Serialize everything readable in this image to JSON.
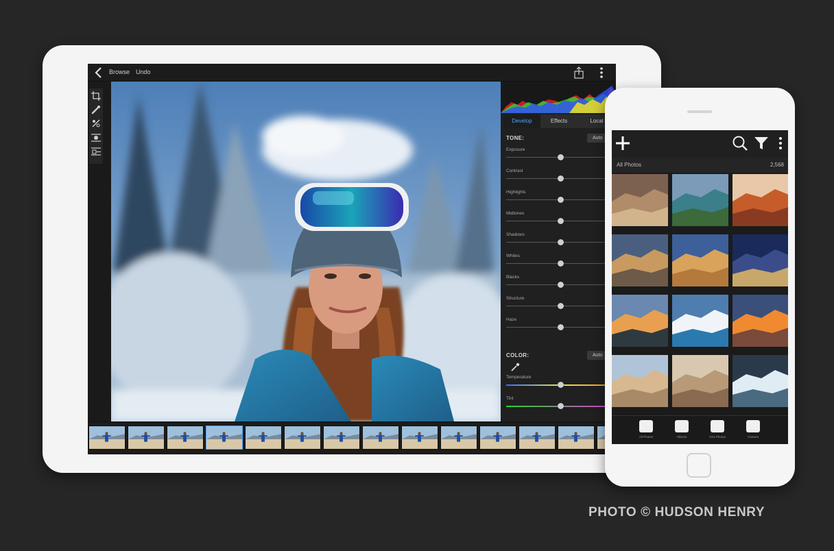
{
  "tablet": {
    "topbar": {
      "browse_label": "Browse",
      "undo_label": "Undo"
    },
    "tools": [
      "crop-icon",
      "heal-brush-icon",
      "selective-brush-icon",
      "redeye-icon",
      "adjustments-icon"
    ],
    "panel": {
      "tabs": [
        {
          "label": "Develop",
          "active": true
        },
        {
          "label": "Effects",
          "active": false
        },
        {
          "label": "Local",
          "active": false
        }
      ],
      "tone": {
        "title": "TONE:",
        "auto_label": "Auto",
        "sliders": [
          {
            "label": "Exposure",
            "value": 0.5
          },
          {
            "label": "Contrast",
            "value": 0.5
          },
          {
            "label": "Highlights",
            "value": 0.5
          },
          {
            "label": "Midtones",
            "value": 0.5
          },
          {
            "label": "Shadows",
            "value": 0.5
          },
          {
            "label": "Whites",
            "value": 0.5
          },
          {
            "label": "Blacks",
            "value": 0.5
          },
          {
            "label": "Structure",
            "value": 0.5
          },
          {
            "label": "Haze",
            "value": 0.5
          }
        ]
      },
      "color": {
        "title": "COLOR:",
        "auto_label": "Auto",
        "sliders": [
          {
            "label": "Temperature",
            "value": 0.5
          },
          {
            "label": "Tint",
            "value": 0.5
          }
        ]
      }
    },
    "filmstrip": {
      "thumb_count": 14,
      "selected_index": 3
    }
  },
  "phone": {
    "subbar": {
      "label": "All Photos",
      "count": "2,568"
    },
    "grid_count": 12,
    "tabs": [
      {
        "label": "All Photos",
        "icon": "grid-icon"
      },
      {
        "label": "Albums",
        "icon": "albums-icon"
      },
      {
        "label": "On1 Photos",
        "icon": "on1-photos-icon"
      },
      {
        "label": "Camera",
        "icon": "camera-icon"
      }
    ]
  },
  "credit": "PHOTO © HUDSON HENRY",
  "colors": {
    "accent": "#4da3ff",
    "background": "#262626"
  }
}
